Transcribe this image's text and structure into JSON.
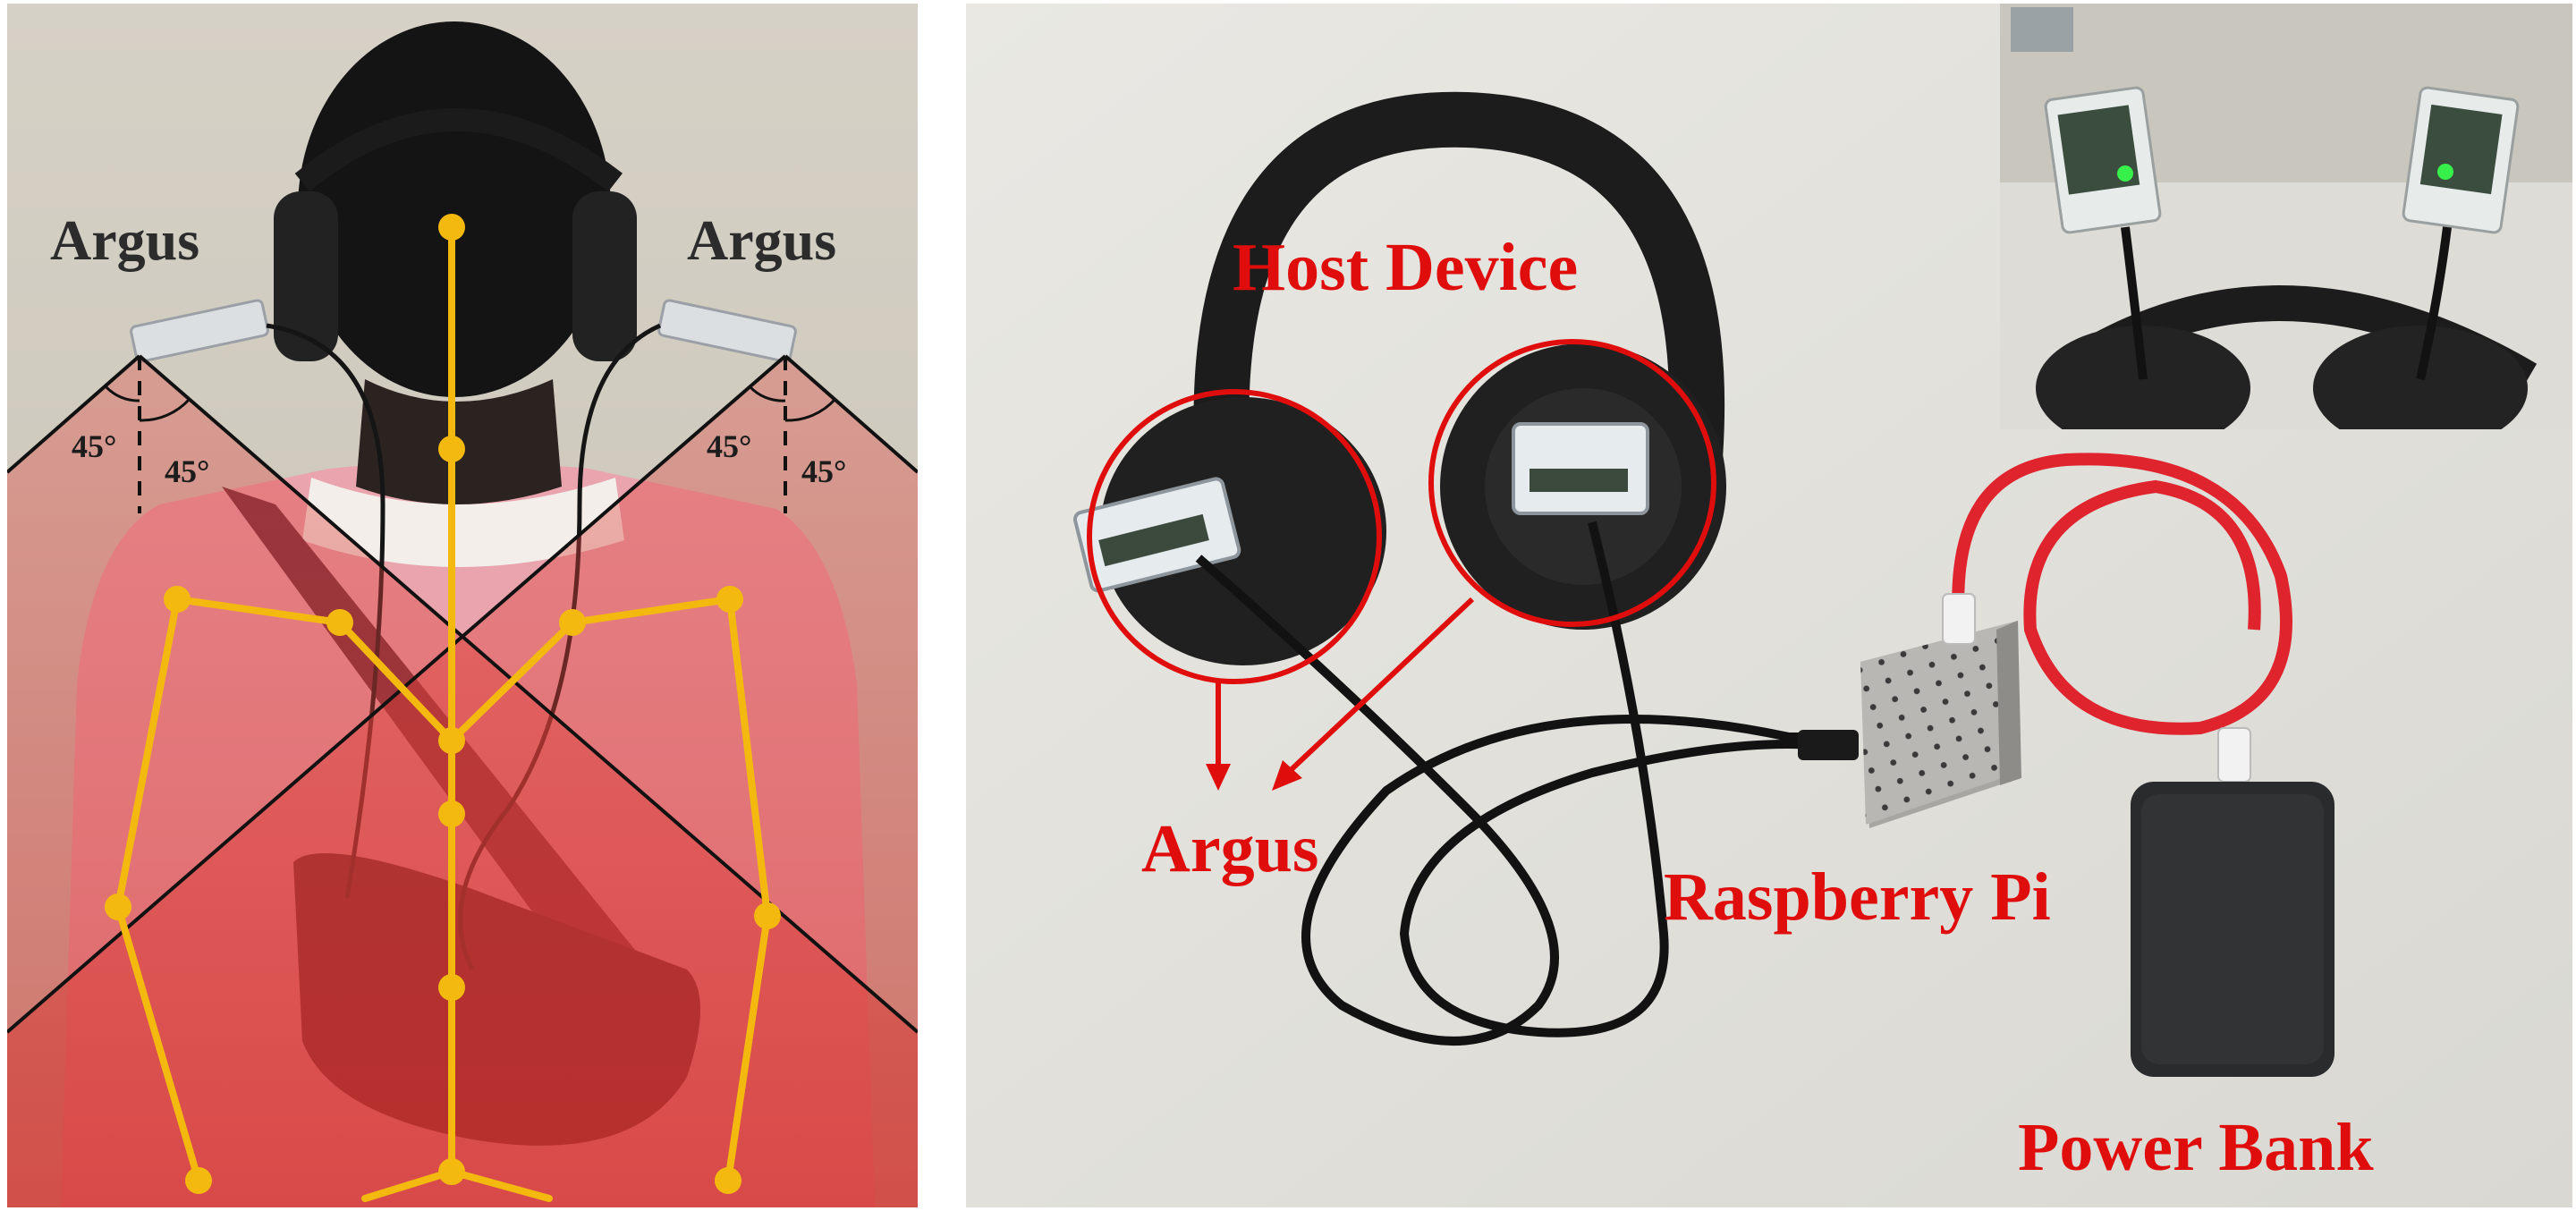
{
  "left_panel": {
    "labels": {
      "argus_left": "Argus",
      "argus_right": "Argus",
      "angles": [
        "45°",
        "45°",
        "45°",
        "45°"
      ]
    },
    "colors": {
      "skeleton": "#f4b90f",
      "coverage_tint": "#e0463f",
      "shirt": "#e9a4ae",
      "hair": "#141414",
      "wall": "#cfc9bd"
    }
  },
  "right_panel": {
    "labels": {
      "host_device": "Host Device",
      "argus": "Argus",
      "raspberry_pi": "Raspberry Pi",
      "power_bank": "Power Bank"
    },
    "colors": {
      "annotation": "#e00d0d",
      "cable_red": "#e0242e",
      "table": "#e3e2dd"
    }
  }
}
